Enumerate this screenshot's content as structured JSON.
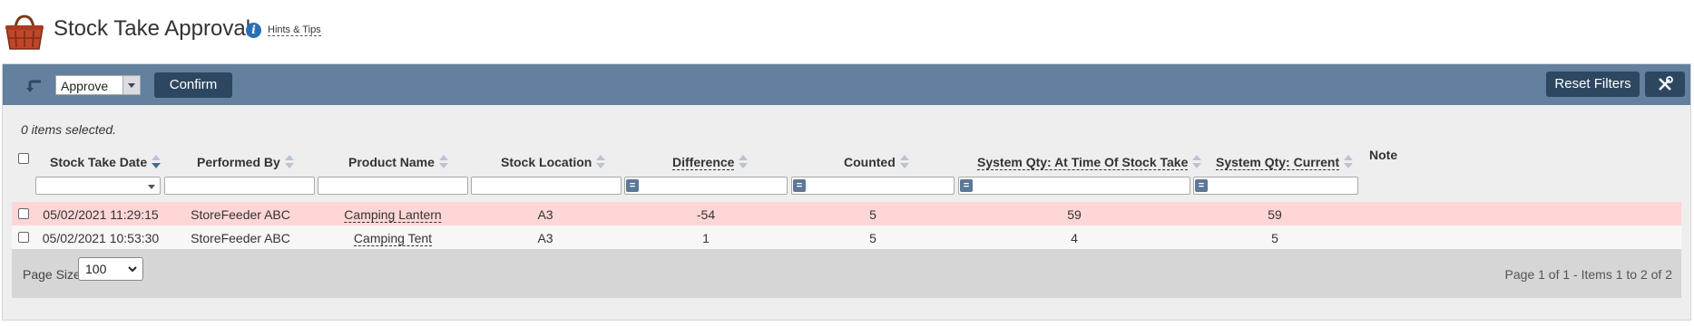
{
  "header": {
    "title": "Stock Take Approval",
    "hints_label": "Hints & Tips"
  },
  "toolbar": {
    "action_value": "Approve",
    "confirm_label": "Confirm",
    "reset_filters_label": "Reset Filters"
  },
  "selection_status": "0 items selected.",
  "columns": {
    "stock_take_date": "Stock Take Date",
    "performed_by": "Performed By",
    "product_name": "Product Name",
    "stock_location": "Stock Location",
    "difference": "Difference",
    "counted": "Counted",
    "system_qty_at_time": "System Qty: At Time Of Stock Take",
    "system_qty_current": "System Qty: Current",
    "note": "Note"
  },
  "rows": [
    {
      "date": "05/02/2021 11:29:15",
      "performed_by": "StoreFeeder ABC",
      "product": "Camping Lantern",
      "location": "A3",
      "difference": "-54",
      "counted": "5",
      "sys_at_time": "59",
      "sys_current": "59"
    },
    {
      "date": "05/02/2021 10:53:30",
      "performed_by": "StoreFeeder ABC",
      "product": "Camping Tent",
      "location": "A3",
      "difference": "1",
      "counted": "5",
      "sys_at_time": "4",
      "sys_current": "5"
    }
  ],
  "footer": {
    "page_size_label": "Page Size:",
    "page_size_value": "100",
    "page_info": "Page 1 of 1  -  Items 1 to 2 of 2"
  },
  "colors": {
    "toolbar": "#64809f",
    "button_dark": "#2d4760",
    "highlight_row": "#ffd6d6"
  }
}
